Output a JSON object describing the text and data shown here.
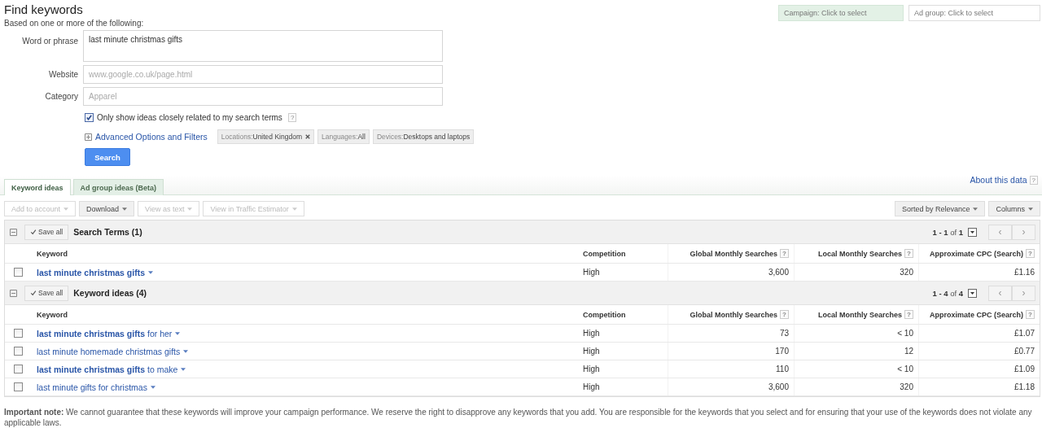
{
  "header": {
    "title": "Find keywords",
    "subtitle": "Based on one or more of the following:",
    "campaign_selector": "Campaign: Click to select",
    "ad_group_selector": "Ad group: Click to select"
  },
  "form": {
    "fields": [
      {
        "label": "Word or phrase",
        "value": "last minute christmas gifts",
        "kind": "textarea"
      },
      {
        "label": "Website",
        "placeholder": "www.google.co.uk/page.html",
        "kind": "input"
      },
      {
        "label": "Category",
        "placeholder": "Apparel",
        "kind": "input"
      }
    ],
    "closely_related": {
      "label": "Only show ideas closely related to my search terms",
      "checked": true,
      "help": "?"
    },
    "advanced_link": "Advanced Options and Filters",
    "filters": [
      {
        "name": "Locations:",
        "value": "United Kingdom",
        "removable": true
      },
      {
        "name": "Languages:",
        "value": "All",
        "removable": false
      },
      {
        "name": "Devices:",
        "value": "Desktops and laptops",
        "removable": false
      }
    ],
    "search_button": "Search"
  },
  "tabs": [
    {
      "label": "Keyword ideas",
      "selected": true
    },
    {
      "label": "Ad group ideas (Beta)",
      "selected": false
    }
  ],
  "about_link": {
    "label": "About this data",
    "help": "?"
  },
  "toolbar": {
    "left": [
      {
        "label": "Add to account",
        "disabled": true
      },
      {
        "label": "Download",
        "disabled": false
      },
      {
        "label": "View as text",
        "disabled": true
      },
      {
        "label": "View in Traffic Estimator",
        "disabled": true
      }
    ],
    "right": [
      {
        "label": "Sorted by Relevance",
        "disabled": false
      },
      {
        "label": "Columns",
        "disabled": false
      }
    ]
  },
  "groups": [
    {
      "kind": "search_terms",
      "save_all": "Save all",
      "title": "Search Terms (1)",
      "range": "1 - 1",
      "of": "of",
      "total": "1",
      "prev": "‹",
      "next": "›",
      "columns": [
        {
          "label": "Keyword"
        },
        {
          "label": "Competition"
        },
        {
          "label": "Global Monthly Searches",
          "help": "?"
        },
        {
          "label": "Local Monthly Searches",
          "help": "?"
        },
        {
          "label": "Approximate CPC (Search)",
          "help": "?"
        }
      ],
      "rows": [
        {
          "keyword": "last minute christmas gifts",
          "competition": "High",
          "global": "3,600",
          "local": "320",
          "cpc": "£1.16",
          "checked": false
        }
      ]
    },
    {
      "kind": "ideas",
      "save_all": "Save all",
      "title": "Keyword ideas (4)",
      "range": "1 - 4",
      "of": "of",
      "total": "4",
      "prev": "‹",
      "next": "›",
      "columns": [
        {
          "label": "Keyword"
        },
        {
          "label": "Competition"
        },
        {
          "label": "Global Monthly Searches",
          "help": "?"
        },
        {
          "label": "Local Monthly Searches",
          "help": "?"
        },
        {
          "label": "Approximate CPC (Search)",
          "help": "?"
        }
      ],
      "rows": [
        {
          "keyword": "**last minute christmas gifts** for her",
          "competition": "High",
          "global": "73",
          "local": "< 10",
          "cpc": "£1.07",
          "checked": false
        },
        {
          "keyword": "last minute homemade christmas gifts",
          "competition": "High",
          "global": "170",
          "local": "12",
          "cpc": "£0.77",
          "checked": false
        },
        {
          "keyword": "**last minute christmas gifts** to make",
          "competition": "High",
          "global": "110",
          "local": "< 10",
          "cpc": "£1.09",
          "checked": false
        },
        {
          "keyword": "last minute gifts for christmas",
          "competition": "High",
          "global": "3,600",
          "local": "320",
          "cpc": "£1.18",
          "checked": false
        }
      ]
    }
  ],
  "note": "**Important note:** We cannot guarantee that these keywords will improve your campaign performance. We reserve the right to disapprove any keywords that you add. You are responsible for the keywords that you select and for ensuring that your use of the keywords does not violate any applicable laws."
}
